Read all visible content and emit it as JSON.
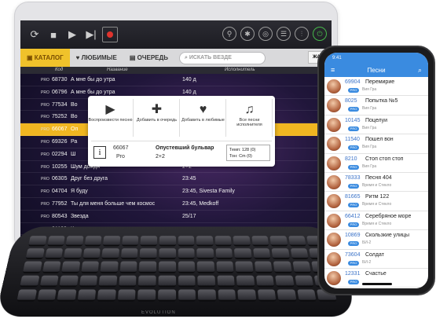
{
  "tablet": {
    "nav": {
      "catalog": "КАТАЛОГ",
      "favorites": "ЛЮБИМЫЕ",
      "queue": "ОЧЕРЕДЬ",
      "search_placeholder": "ИСКАТЬ ВЕЗДЕ",
      "genre": "ЖАНР"
    },
    "columns": {
      "code": "Код",
      "title": "Название",
      "artist": "Исполнитель"
    },
    "songs": [
      {
        "code": "68730",
        "title": "А мне бы до утра",
        "artist": "140 д"
      },
      {
        "code": "06796",
        "title": "А мне бы до утра",
        "artist": "140 д"
      },
      {
        "code": "77534",
        "title": "Во",
        "artist": ""
      },
      {
        "code": "75252",
        "title": "Во",
        "artist": ""
      },
      {
        "code": "66067",
        "title": "Оп",
        "artist": ""
      },
      {
        "code": "69326",
        "title": "Ра",
        "artist": ""
      },
      {
        "code": "02294",
        "title": "Ш",
        "artist": ""
      },
      {
        "code": "10255",
        "title": "Шум дождя",
        "artist": "2+2"
      },
      {
        "code": "06305",
        "title": "Друг без друга",
        "artist": "23:45"
      },
      {
        "code": "04704",
        "title": "Я буду",
        "artist": "23:45, Sivesta Family"
      },
      {
        "code": "77952",
        "title": "Ты для меня больше чем космос",
        "artist": "23:45, Medkoff"
      },
      {
        "code": "80543",
        "title": "Звезда",
        "artist": "25/17"
      },
      {
        "code": "81133",
        "title": "Комната",
        "artist": ""
      }
    ],
    "popup": {
      "actions": [
        {
          "icon": "play-icon",
          "label": "Воспроизвести песню"
        },
        {
          "icon": "add-queue-icon",
          "label": "Добавить в очередь"
        },
        {
          "icon": "heart-icon",
          "label": "Добавить в любимые"
        },
        {
          "icon": "artist-songs-icon",
          "label": "Все песни исполнителя"
        }
      ],
      "number": "66067",
      "version": "Pro",
      "title": "Опустевший бульвар",
      "artist": "2+2",
      "tempo": "Темп: 128 (0)",
      "key": "Тон: Cm (0)"
    }
  },
  "phone": {
    "time": "9:41",
    "title": "Песни",
    "items": [
      {
        "num": "69904",
        "title": "Перемирие",
        "artist": "Вия Гра"
      },
      {
        "num": "8025",
        "title": "Попытка №5",
        "artist": "Вия Гра"
      },
      {
        "num": "10145",
        "title": "Поцелуи",
        "artist": "Вия Гра"
      },
      {
        "num": "11540",
        "title": "Пошел вон",
        "artist": "Вия Гра"
      },
      {
        "num": "8210",
        "title": "Стоп стоп стоп",
        "artist": "Вия Гра"
      },
      {
        "num": "78333",
        "title": "Песня 404",
        "artist": "Время и Стекло"
      },
      {
        "num": "81665",
        "title": "Ритм 122",
        "artist": "Время и Стекло"
      },
      {
        "num": "66412",
        "title": "Серебряное море",
        "artist": "Время и Стекло"
      },
      {
        "num": "10869",
        "title": "Скользкие улицы",
        "artist": "БИ-2"
      },
      {
        "num": "73604",
        "title": "Солдат",
        "artist": "БИ-2"
      },
      {
        "num": "12331",
        "title": "Счастье",
        "artist": ""
      }
    ],
    "badge": "PRO"
  },
  "keyboard": {
    "brand": "EVOLUTION"
  }
}
